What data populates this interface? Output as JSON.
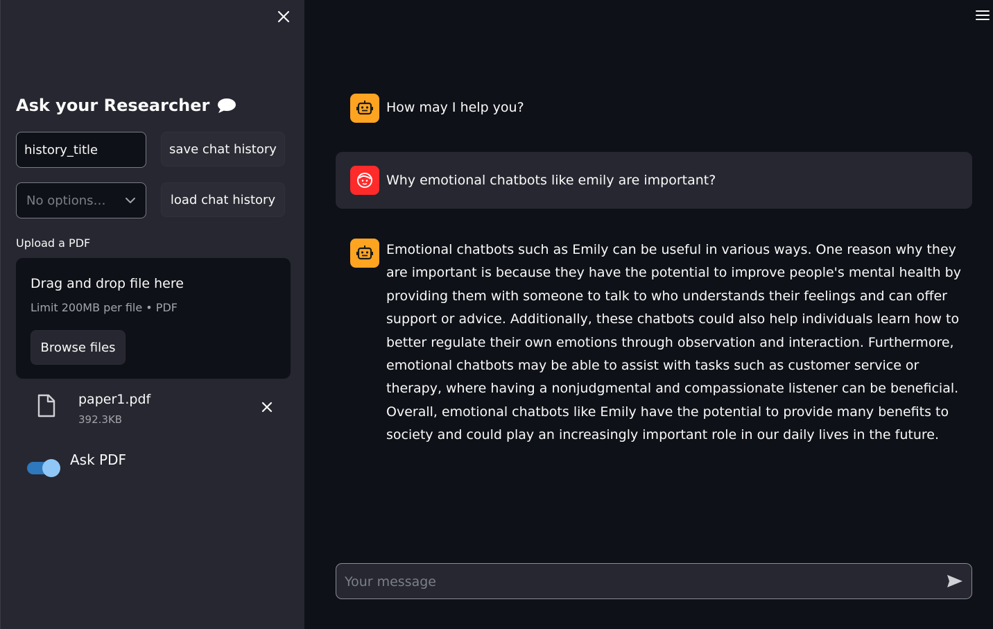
{
  "colors": {
    "sidebar_bg": "#262730",
    "main_bg": "#0e1117",
    "bot_avatar": "#ffa421",
    "user_avatar": "#ff2b2b",
    "toggle_on": "#2e78bd"
  },
  "sidebar": {
    "close_icon": "close-icon",
    "title": "Ask your Researcher",
    "title_icon": "speech-bubble-icon",
    "history_input": {
      "value": "history_title"
    },
    "history_select": {
      "value": "No options…"
    },
    "save_button": "save chat history",
    "load_button": "load chat history",
    "uploader": {
      "label": "Upload a PDF",
      "dropzone_title": "Drag and drop file here",
      "limit_text": "Limit 200MB per file • PDF",
      "browse_button": "Browse files"
    },
    "uploaded_file": {
      "name": "paper1.pdf",
      "size": "392.3KB",
      "icon": "file-icon"
    },
    "toggle": {
      "label": "Ask PDF",
      "on": true
    }
  },
  "main": {
    "menu_icon": "hamburger-menu-icon",
    "messages": [
      {
        "role": "assistant",
        "avatar_icon": "robot-icon",
        "text": "How may I help you?"
      },
      {
        "role": "user",
        "avatar_icon": "face-icon",
        "text": "Why emotional chatbots like emily are important?"
      },
      {
        "role": "assistant",
        "avatar_icon": "robot-icon",
        "text": "Emotional chatbots such as Emily can be useful in various ways. One reason why they are important is because they have the potential to improve people's mental health by providing them with someone to talk to who understands their feelings and can offer support or advice. Additionally, these chatbots could also help individuals learn how to better regulate their own emotions through observation and interaction. Furthermore, emotional chatbots may be able to assist with tasks such as customer service or therapy, where having a nonjudgmental and compassionate listener can be beneficial. Overall, emotional chatbots like Emily have the potential to provide many benefits to society and could play an increasingly important role in our daily lives in the future."
      }
    ],
    "chat_input": {
      "placeholder": "Your message",
      "value": ""
    }
  }
}
